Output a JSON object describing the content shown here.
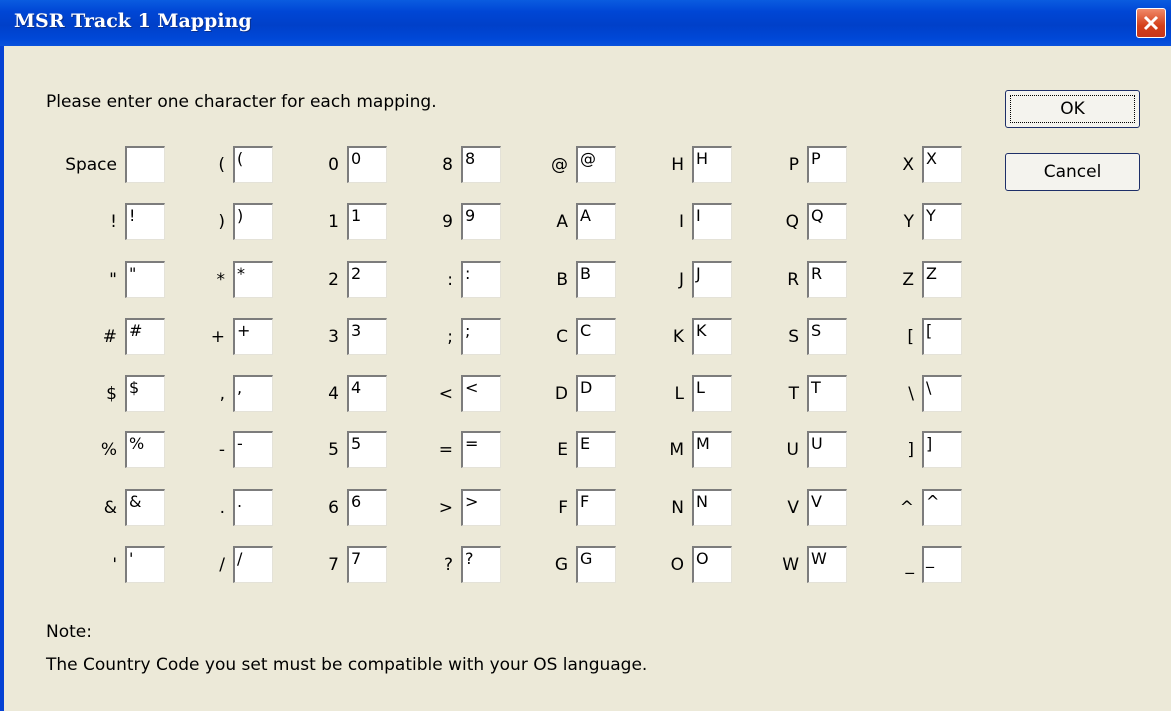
{
  "window": {
    "title": "MSR Track 1 Mapping",
    "close_icon": "close-icon"
  },
  "instruction": "Please enter one character for each mapping.",
  "buttons": {
    "ok": "OK",
    "cancel": "Cancel"
  },
  "columns": [
    [
      {
        "label": "Space",
        "value": ""
      },
      {
        "label": "!",
        "value": "!"
      },
      {
        "label": "\"",
        "value": "\""
      },
      {
        "label": "#",
        "value": "#"
      },
      {
        "label": "$",
        "value": "$"
      },
      {
        "label": "%",
        "value": "%"
      },
      {
        "label": "&",
        "value": "&"
      },
      {
        "label": "'",
        "value": "'"
      }
    ],
    [
      {
        "label": "(",
        "value": "("
      },
      {
        "label": ")",
        "value": ")"
      },
      {
        "label": "*",
        "value": "*"
      },
      {
        "label": "+",
        "value": "+"
      },
      {
        "label": ",",
        "value": ","
      },
      {
        "label": "-",
        "value": "-"
      },
      {
        "label": ".",
        "value": "."
      },
      {
        "label": "/",
        "value": "/"
      }
    ],
    [
      {
        "label": "0",
        "value": "0"
      },
      {
        "label": "1",
        "value": "1"
      },
      {
        "label": "2",
        "value": "2"
      },
      {
        "label": "3",
        "value": "3"
      },
      {
        "label": "4",
        "value": "4"
      },
      {
        "label": "5",
        "value": "5"
      },
      {
        "label": "6",
        "value": "6"
      },
      {
        "label": "7",
        "value": "7"
      }
    ],
    [
      {
        "label": "8",
        "value": "8"
      },
      {
        "label": "9",
        "value": "9"
      },
      {
        "label": ":",
        "value": ":"
      },
      {
        "label": ";",
        "value": ";"
      },
      {
        "label": "<",
        "value": "<"
      },
      {
        "label": "=",
        "value": "="
      },
      {
        "label": ">",
        "value": ">"
      },
      {
        "label": "?",
        "value": "?"
      }
    ],
    [
      {
        "label": "@",
        "value": "@"
      },
      {
        "label": "A",
        "value": "A"
      },
      {
        "label": "B",
        "value": "B"
      },
      {
        "label": "C",
        "value": "C"
      },
      {
        "label": "D",
        "value": "D"
      },
      {
        "label": "E",
        "value": "E"
      },
      {
        "label": "F",
        "value": "F"
      },
      {
        "label": "G",
        "value": "G"
      }
    ],
    [
      {
        "label": "H",
        "value": "H"
      },
      {
        "label": "I",
        "value": "I"
      },
      {
        "label": "J",
        "value": "J"
      },
      {
        "label": "K",
        "value": "K"
      },
      {
        "label": "L",
        "value": "L"
      },
      {
        "label": "M",
        "value": "M"
      },
      {
        "label": "N",
        "value": "N"
      },
      {
        "label": "O",
        "value": "O"
      }
    ],
    [
      {
        "label": "P",
        "value": "P"
      },
      {
        "label": "Q",
        "value": "Q"
      },
      {
        "label": "R",
        "value": "R"
      },
      {
        "label": "S",
        "value": "S"
      },
      {
        "label": "T",
        "value": "T"
      },
      {
        "label": "U",
        "value": "U"
      },
      {
        "label": "V",
        "value": "V"
      },
      {
        "label": "W",
        "value": "W"
      }
    ],
    [
      {
        "label": "X",
        "value": "X"
      },
      {
        "label": "Y",
        "value": "Y"
      },
      {
        "label": "Z",
        "value": "Z"
      },
      {
        "label": "[",
        "value": "["
      },
      {
        "label": "\\",
        "value": "\\"
      },
      {
        "label": "]",
        "value": "]"
      },
      {
        "label": "^",
        "value": "^"
      },
      {
        "label": "_",
        "value": "_"
      }
    ]
  ],
  "note": {
    "heading": "Note:",
    "text": "The Country Code you set must be compatible with your OS language."
  },
  "colors": {
    "titlebar": "#0046d5",
    "dialog_bg": "#ece9d8",
    "close_button": "#d4401a"
  }
}
